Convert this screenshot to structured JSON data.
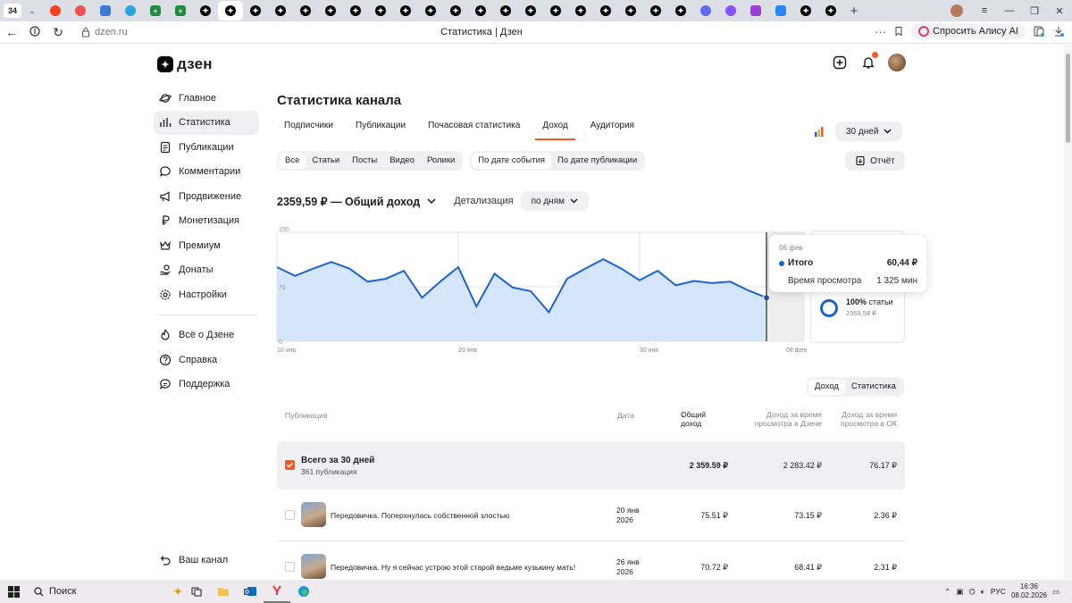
{
  "browser": {
    "tab_count": "34",
    "url": "dzen.ru",
    "page_title": "Статистика | Дзен",
    "alice_button": "Спросить Алису AI",
    "tab_favicons": [
      "yandex",
      "red",
      "cloud",
      "telegram",
      "sheets",
      "sheets",
      "dzen",
      "dzen",
      "dzen",
      "dzen",
      "dzen",
      "dzen",
      "dzen",
      "dzen",
      "dzen",
      "dzen",
      "dzen",
      "dzen",
      "dzen",
      "dzen",
      "dzen",
      "dzen",
      "dzen",
      "dzen",
      "dzen",
      "dzen",
      "planet",
      "purple",
      "purple-glyph",
      "vk",
      "dzen",
      "dzen"
    ]
  },
  "header": {
    "logo_text": "дзен"
  },
  "sidebar": {
    "items": [
      {
        "label": "Главное",
        "icon": "planet-icon"
      },
      {
        "label": "Статистика",
        "icon": "bar-chart-icon"
      },
      {
        "label": "Публикации",
        "icon": "document-icon"
      },
      {
        "label": "Комментарии",
        "icon": "comment-icon"
      },
      {
        "label": "Продвижение",
        "icon": "megaphone-icon"
      },
      {
        "label": "Монетизация",
        "icon": "ruble-icon"
      },
      {
        "label": "Премиум",
        "icon": "crown-icon"
      },
      {
        "label": "Донаты",
        "icon": "donate-icon"
      },
      {
        "label": "Настройки",
        "icon": "gear-icon"
      }
    ],
    "secondary": [
      {
        "label": "Всё о Дзене",
        "icon": "flame-icon"
      },
      {
        "label": "Справка",
        "icon": "help-icon"
      },
      {
        "label": "Поддержка",
        "icon": "support-icon"
      }
    ],
    "bottom": {
      "label": "Ваш канал",
      "icon": "return-icon"
    }
  },
  "main": {
    "title": "Статистика канала",
    "tabs": [
      "Подписчики",
      "Публикации",
      "Почасовая статистика",
      "Доход",
      "Аудитория"
    ],
    "active_tab": "Доход",
    "period": "30 дней",
    "content_filters": [
      "Все",
      "Статьи",
      "Посты",
      "Видео",
      "Ролики"
    ],
    "date_filters": [
      "По дате события",
      "По дате публикации"
    ],
    "report_button": "Отчёт",
    "total_label": "2359,59 ₽ — Общий доход",
    "detail_label": "Детализация",
    "detail_value": "по дням"
  },
  "chart_data": {
    "type": "area",
    "title": "",
    "x": [
      "10 янв",
      "11 янв",
      "12 янв",
      "13 янв",
      "14 янв",
      "15 янв",
      "16 янв",
      "17 янв",
      "18 янв",
      "19 янв",
      "20 янв",
      "21 янв",
      "22 янв",
      "23 янв",
      "24 янв",
      "25 янв",
      "26 янв",
      "27 янв",
      "28 янв",
      "29 янв",
      "30 янв",
      "31 янв",
      "01 фев",
      "02 фев",
      "03 фев",
      "04 фев",
      "05 фев",
      "06 фев"
    ],
    "xticks": [
      "10 янв",
      "20 янв",
      "30 янв",
      "08 фев"
    ],
    "yticks": [
      "150",
      "75",
      "0"
    ],
    "ylim": [
      0,
      150
    ],
    "series": [
      {
        "name": "Итого",
        "values": [
          102,
          90,
          100,
          109,
          100,
          82,
          86,
          97,
          60,
          82,
          102,
          48,
          93,
          74,
          69,
          40,
          86,
          100,
          113,
          100,
          84,
          97,
          77,
          83,
          80,
          82,
          70,
          60
        ]
      }
    ],
    "color": "#1e62d3",
    "fill": "#d6e6fa",
    "grid": true
  },
  "tooltip": {
    "date": "06 фев",
    "rows": [
      {
        "label": "Итого",
        "value": "60,44 ₽"
      },
      {
        "label": "Время просмотра",
        "value": "1 325 мин"
      }
    ]
  },
  "legend": {
    "pct": "100%",
    "pct_label": "статьи",
    "sub": "2359,58 ₽"
  },
  "table": {
    "toggle": [
      "Доход",
      "Статистика"
    ],
    "headers": {
      "publication": "Публикация",
      "date": "Дата",
      "income": "Общий доход",
      "dzen_time": "Доход за время просмотра в Дзене",
      "ok_time": "Доход за время просмотра в ОК"
    },
    "total": {
      "title": "Всего за 30 дней",
      "subtitle": "361 публикация",
      "income": "2 359.59 ₽",
      "dzen": "2 283.42 ₽",
      "ok": "76.17 ₽"
    },
    "rows": [
      {
        "title": "Передовичка. Поперхнулась собственной злостью",
        "date1": "20 янв",
        "date2": "2026",
        "income": "75.51 ₽",
        "dzen": "73.15 ₽",
        "ok": "2.36 ₽"
      },
      {
        "title": "Передовичка. Ну я сейчас устрою этой старой ведьме кузькину мать!",
        "date1": "26 янв",
        "date2": "2026",
        "income": "70.72 ₽",
        "dzen": "68.41 ₽",
        "ok": "2.31 ₽"
      }
    ]
  },
  "taskbar": {
    "search": "Поиск",
    "lang": "РУС",
    "time": "16:36",
    "date": "08.02.2026"
  }
}
